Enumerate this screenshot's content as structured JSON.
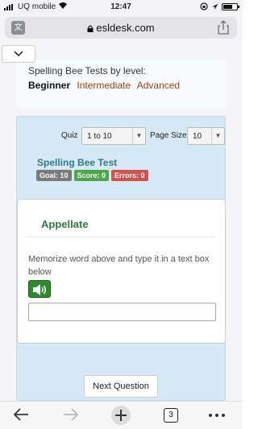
{
  "status_bar": {
    "carrier": "UQ mobile",
    "time": "12:47"
  },
  "browser": {
    "domain": "esldesk.com",
    "translate_icon": "translate-icon",
    "lock_icon": "lock-icon",
    "share_icon": "share-icon"
  },
  "levels": {
    "caption": "Spelling Bee Tests by level:",
    "items": [
      "Beginner",
      "Intermediate",
      "Advanced"
    ]
  },
  "quiz": {
    "quiz_label": "Quiz",
    "quiz_value": "1 to 10",
    "page_size_label": "Page Size",
    "page_size_value": "10",
    "title": "Spelling Bee Test",
    "badges": {
      "goal": "Goal: 10",
      "score": "Score: 0",
      "errors": "Errors: 0"
    },
    "word": "Appellate",
    "instruction": "Memorize word above and type it in a text box below",
    "speaker_icon": "speaker-icon",
    "answer_value": "",
    "next_button": "Next Question"
  },
  "toolbar": {
    "tab_count": "3"
  },
  "colors": {
    "panel_blue": "#d6e9f6",
    "level_link": "#a24312",
    "word_green": "#2e7a3e",
    "title_teal": "#2f7a89"
  }
}
